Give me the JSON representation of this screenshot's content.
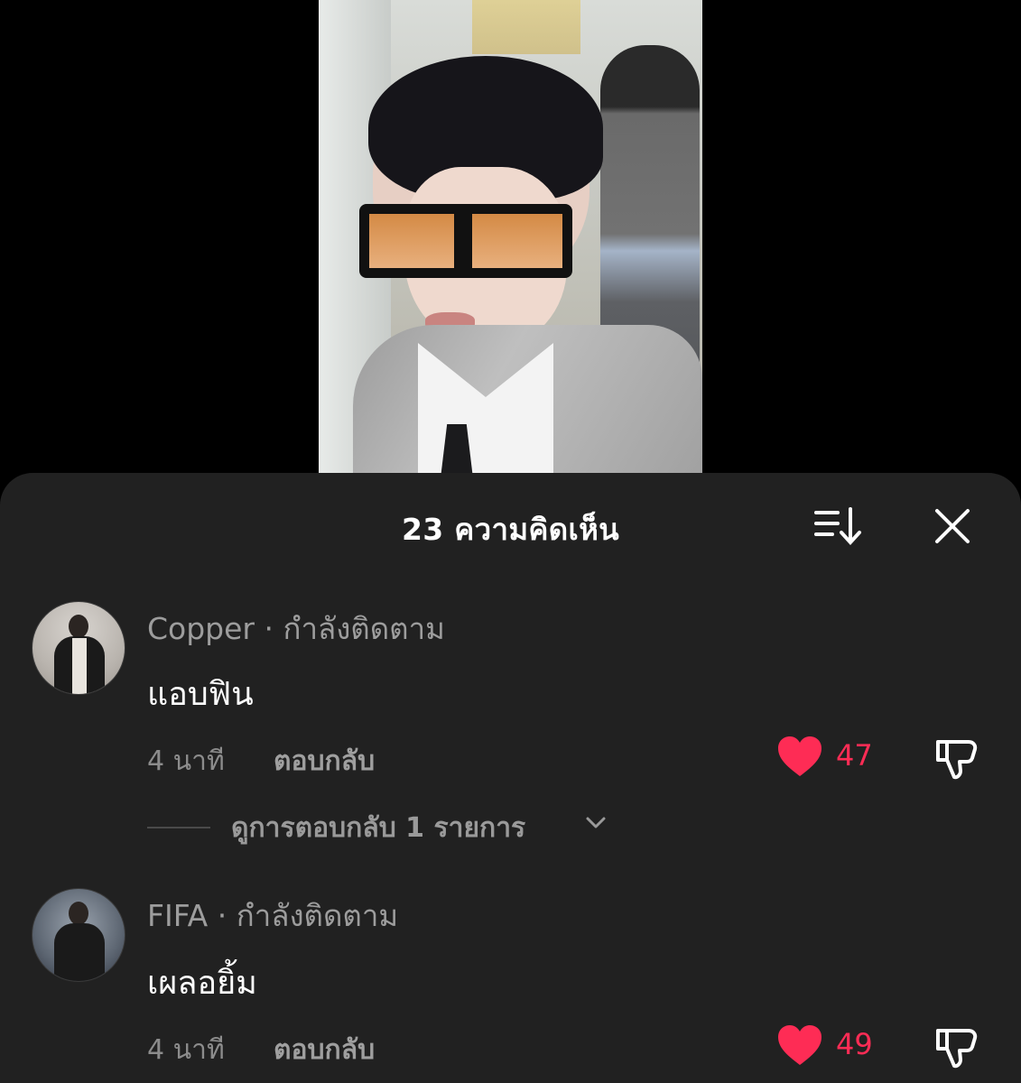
{
  "header": {
    "comment_count_title": "23 ความคิดเห็น",
    "sort_icon": "sort-icon",
    "close_icon": "close-icon"
  },
  "comments": [
    {
      "username": "Copper",
      "follow_status": "กำลังติดตาม",
      "name_line": "Copper · กำลังติดตาม",
      "text": "แอบฟิน",
      "time": "4 นาที",
      "reply_label": "ตอบกลับ",
      "likes": "47",
      "liked": true,
      "view_replies_label": "ดูการตอบกลับ 1 รายการ"
    },
    {
      "username": "FIFA",
      "follow_status": "กำลังติดตาม",
      "name_line": "FIFA · กำลังติดตาม",
      "text": "เผลอยิ้ม",
      "time": "4 นาที",
      "reply_label": "ตอบกลับ",
      "likes": "49",
      "liked": true
    }
  ],
  "colors": {
    "sheet_bg": "#212121",
    "like_red": "#fe2c55",
    "text_primary": "#ffffff",
    "text_secondary": "#9d9d9d"
  }
}
